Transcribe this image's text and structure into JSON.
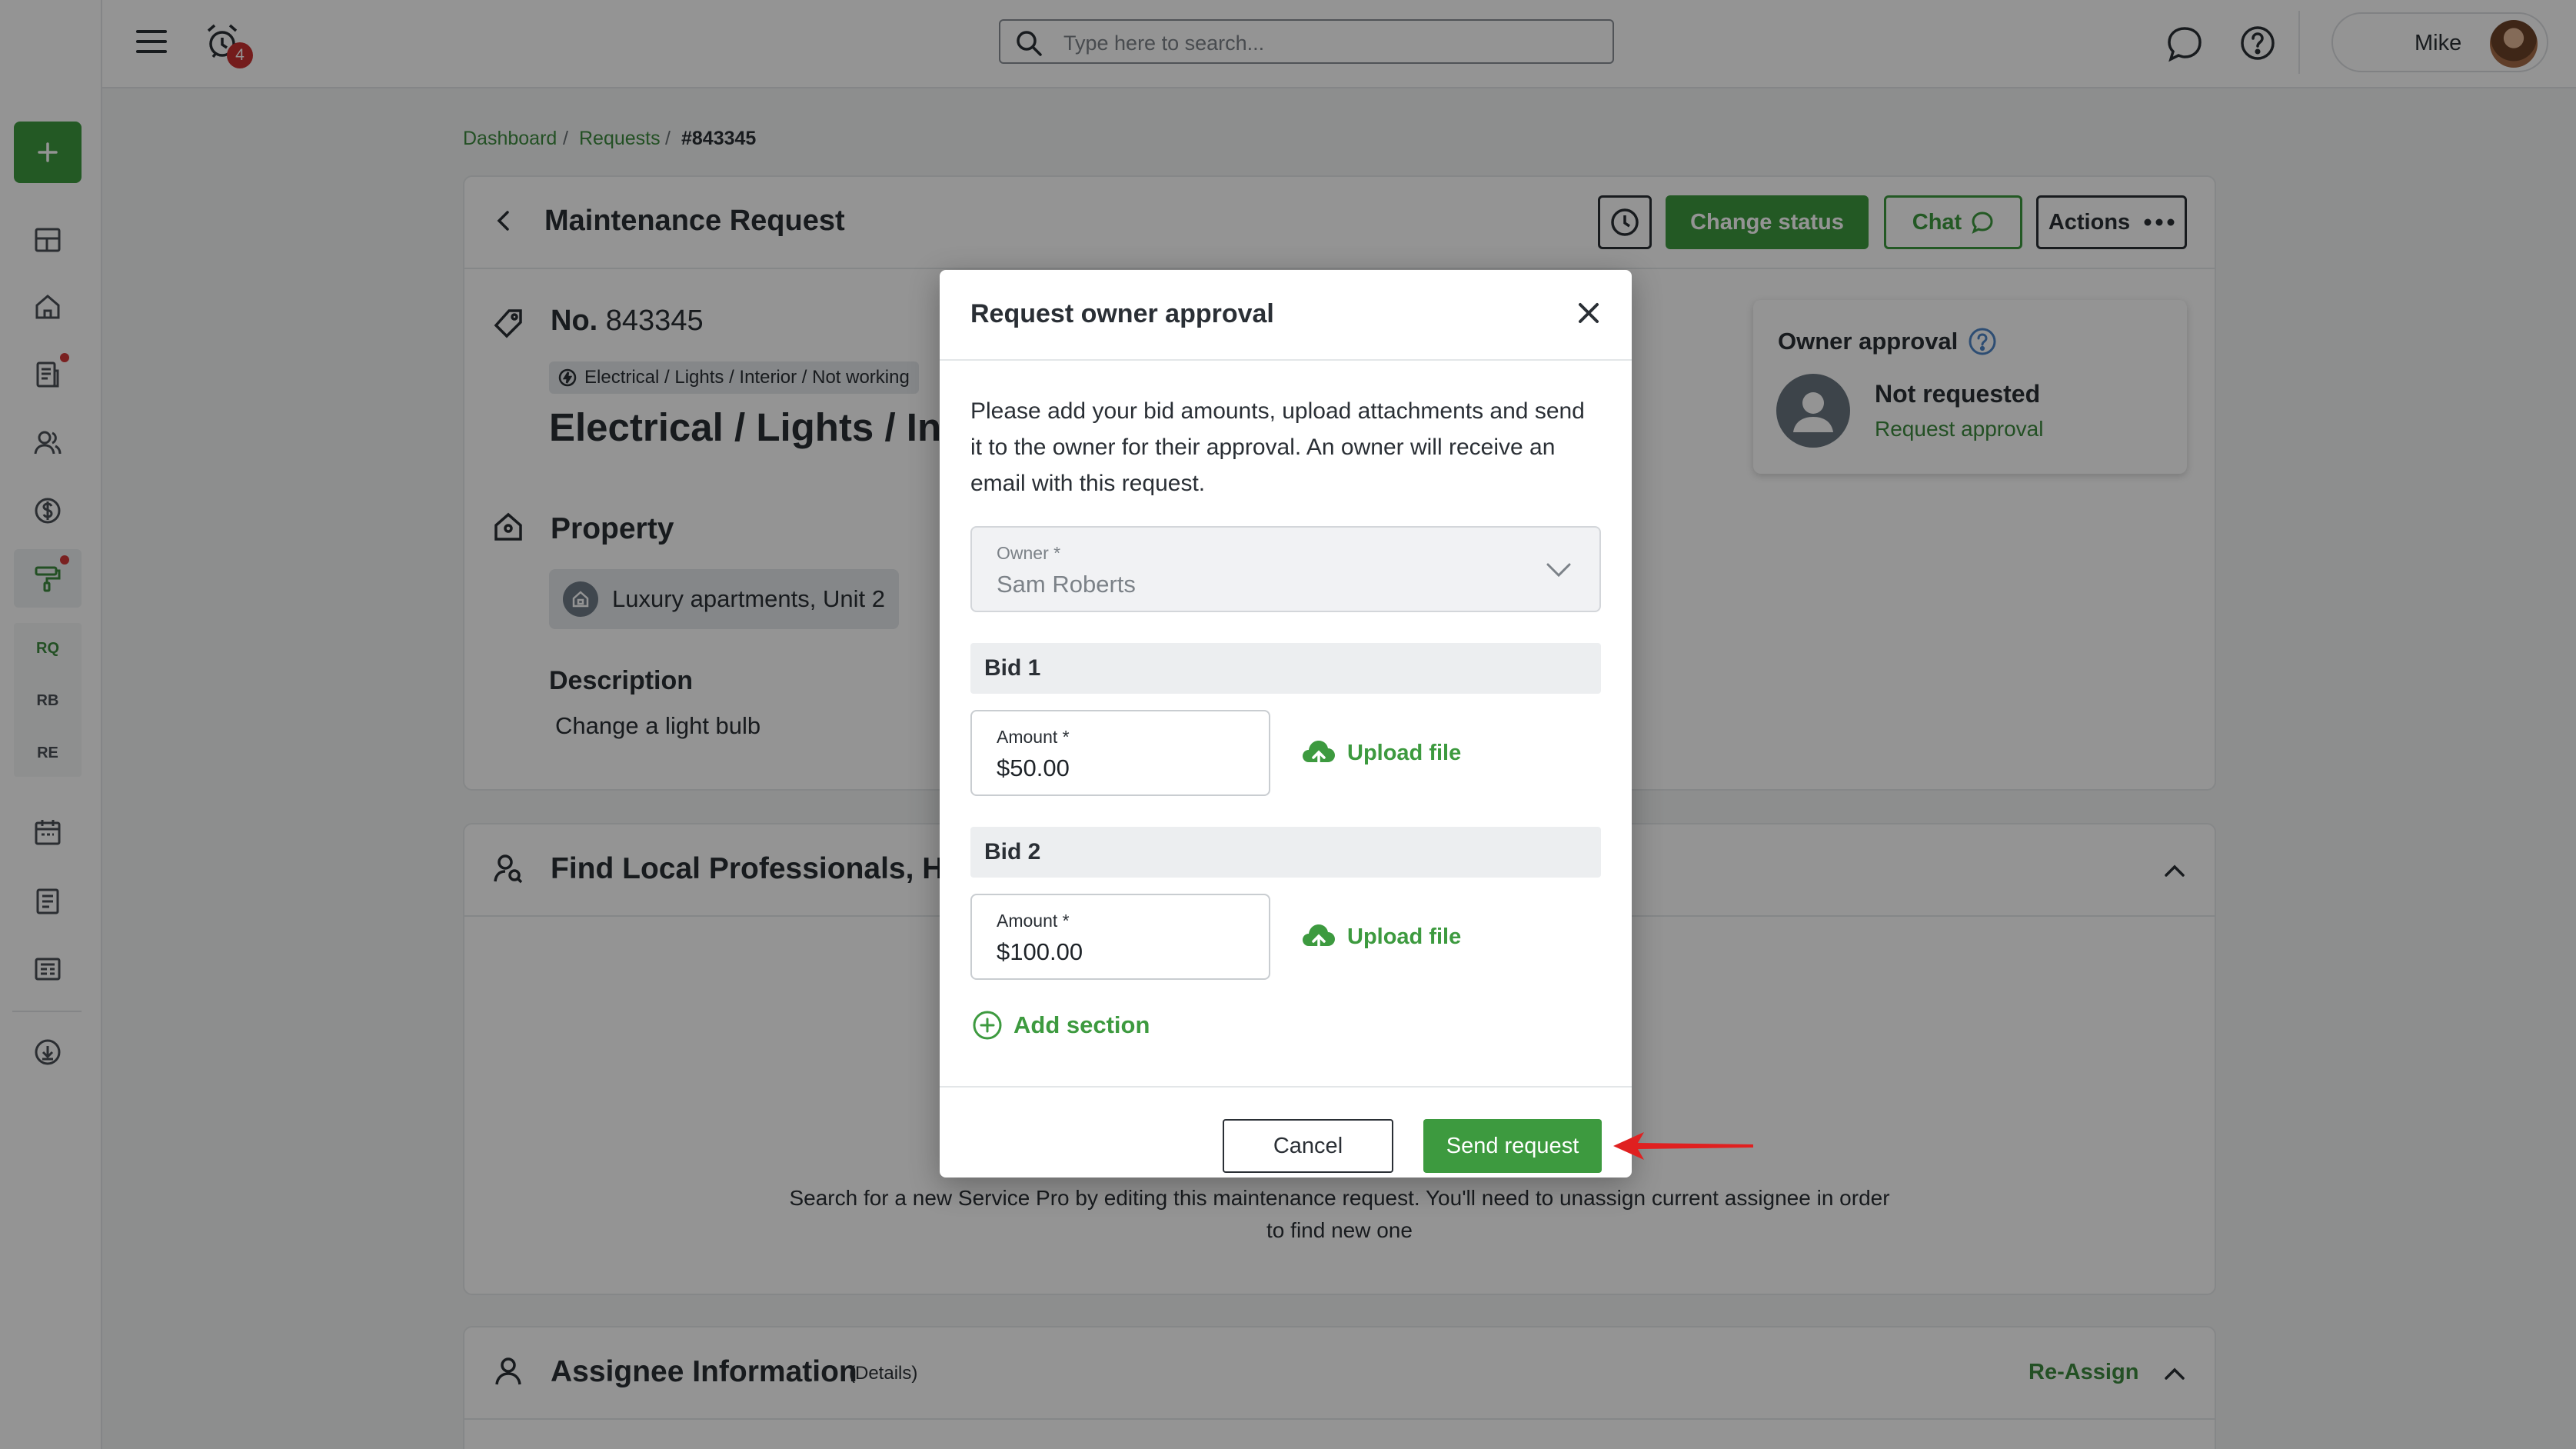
{
  "topbar": {
    "notification_count": "4",
    "search_placeholder": "Type here to search...",
    "user_name": "Mike"
  },
  "sidebar": {
    "text_items": [
      "RQ",
      "RB",
      "RE"
    ]
  },
  "breadcrumb": {
    "items": [
      "Dashboard",
      "Requests",
      "#843345"
    ],
    "separator": "/"
  },
  "request": {
    "header_title": "Maintenance Request",
    "buttons": {
      "change_status": "Change status",
      "chat": "Chat",
      "actions": "Actions"
    },
    "number_label": "No.",
    "number": "843345",
    "category_tag": "Electrical / Lights / Interior / Not working",
    "title": "Electrical / Lights / Inte",
    "property_heading": "Property",
    "property_name": "Luxury apartments, Unit 2",
    "description_heading": "Description",
    "description": "Change a light bulb"
  },
  "owner_approval": {
    "title": "Owner approval",
    "status": "Not requested",
    "link": "Request approval"
  },
  "professionals": {
    "heading": "Find Local Professionals, Har",
    "text_line1": "Search for a new Service Pro by editing this maintenance request. You'll need to unassign current assignee in order",
    "text_line2": "to find new one"
  },
  "assignee": {
    "heading": "Assignee Information",
    "details": "(Details)",
    "reassign": "Re-Assign"
  },
  "modal": {
    "title": "Request owner approval",
    "description": "Please add your bid amounts, upload attachments and send it to the owner for their approval. An owner will receive an email with this request.",
    "owner_label": "Owner *",
    "owner_value": "Sam Roberts",
    "bids": [
      {
        "title": "Bid 1",
        "amount_label": "Amount *",
        "amount": "$50.00",
        "upload": "Upload file"
      },
      {
        "title": "Bid 2",
        "amount_label": "Amount *",
        "amount": "$100.00",
        "upload": "Upload file"
      }
    ],
    "add_section": "Add section",
    "cancel": "Cancel",
    "send": "Send request"
  },
  "colors": {
    "accent_green": "#3d9a3f",
    "text_dark": "#2a2f35",
    "arrow_red": "#e02020",
    "badge_red": "#c93131"
  },
  "icons": [
    "hamburger-menu-icon",
    "alarm-clock-icon",
    "search-icon",
    "chat-bubble-icon",
    "help-icon",
    "tag-icon",
    "home-icon",
    "history-clock-icon",
    "more-dots-icon",
    "close-icon",
    "chevron-down-icon",
    "upload-cloud-icon",
    "add-circle-icon",
    "person-search-icon",
    "person-icon",
    "chevron-up-icon",
    "back-arrow-icon"
  ]
}
